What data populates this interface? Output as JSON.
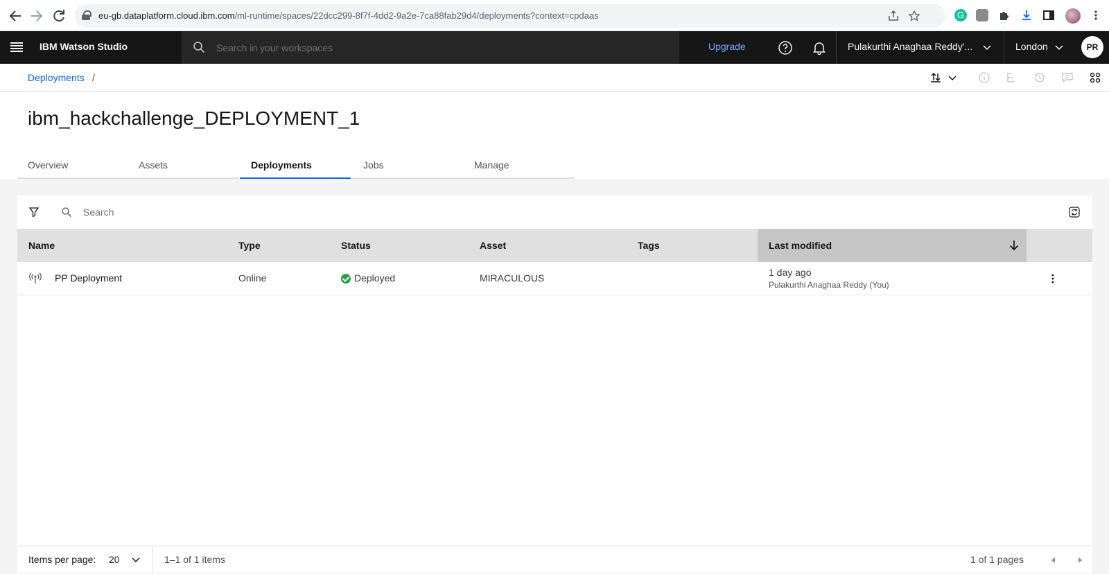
{
  "browser": {
    "url_host": "eu-gb.dataplatform.cloud.ibm.com",
    "url_path": "/ml-runtime/spaces/22dcc299-8f7f-4dd2-9a2e-7ca88fab29d4/deployments?context=cpdaas"
  },
  "header": {
    "product": "IBM Watson Studio",
    "search_placeholder": "Search in your workspaces",
    "upgrade": "Upgrade",
    "account": "Pulakurthi Anaghaa Reddy'...",
    "region": "London",
    "user_initials": "PR"
  },
  "breadcrumb": {
    "items": [
      "Deployments"
    ],
    "separator": "/"
  },
  "page": {
    "title": "ibm_hackchallenge_DEPLOYMENT_1"
  },
  "tabs": [
    {
      "label": "Overview",
      "active": false
    },
    {
      "label": "Assets",
      "active": false
    },
    {
      "label": "Deployments",
      "active": true
    },
    {
      "label": "Jobs",
      "active": false
    },
    {
      "label": "Manage",
      "active": false
    }
  ],
  "table": {
    "search_placeholder": "Search",
    "columns": [
      "Name",
      "Type",
      "Status",
      "Asset",
      "Tags",
      "Last modified"
    ],
    "sorted_column": "Last modified",
    "sort_direction": "descending",
    "rows": [
      {
        "name": "PP Deployment",
        "type": "Online",
        "status": "Deployed",
        "asset": "MIRACULOUS",
        "tags": "",
        "last_modified": "1 day ago",
        "modified_by": "Pulakurthi Anaghaa Reddy (You)"
      }
    ]
  },
  "pagination": {
    "items_per_page_label": "Items per page:",
    "items_per_page": "20",
    "range": "1–1 of 1 items",
    "pages": "1 of 1 pages"
  },
  "colors": {
    "header_bg": "#161616",
    "link_blue": "#0f62fe",
    "upgrade_blue": "#78a9ff",
    "status_green": "#24a148"
  }
}
